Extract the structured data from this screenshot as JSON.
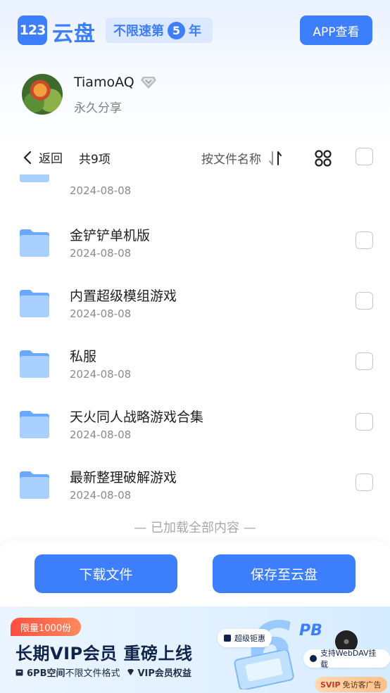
{
  "header": {
    "logo_mark": "123",
    "logo_text": "云盘",
    "promo_prefix": "不限速第",
    "promo_number": "5",
    "promo_suffix": "年",
    "app_button_label": "APP查看"
  },
  "user": {
    "name": "TiamoAQ",
    "share_type": "永久分享"
  },
  "toolbar": {
    "back_label": "返回",
    "count_label": "共9项",
    "sort_label": "按文件名称"
  },
  "files": [
    {
      "name": "",
      "date": "2024-08-08"
    },
    {
      "name": "金铲铲单机版",
      "date": "2024-08-08"
    },
    {
      "name": "内置超级模组游戏",
      "date": "2024-08-08"
    },
    {
      "name": "私服",
      "date": "2024-08-08"
    },
    {
      "name": "天火同人战略游戏合集",
      "date": "2024-08-08"
    },
    {
      "name": "最新整理破解游戏",
      "date": "2024-08-08"
    }
  ],
  "end_note": "— 已加载全部内容 —",
  "actions": {
    "download_label": "下载文件",
    "save_label": "保存至云盘"
  },
  "banner": {
    "limit_badge": "限量1000份",
    "title": "长期VIP会员 重磅上线",
    "feature1_bold": "6PB空间",
    "feature1_rest": "不限文件格式",
    "feature2": "VIP会员权益",
    "chip_rights": "超级钜惠",
    "chip_webdav": "支持WebDAV挂载",
    "pb_label": "PB",
    "pb_number": "6",
    "svip_label": "SVIP",
    "svip_rest": "免访客广告"
  },
  "colors": {
    "accent": "#3d7efc",
    "folder": "#7eb6ff"
  }
}
